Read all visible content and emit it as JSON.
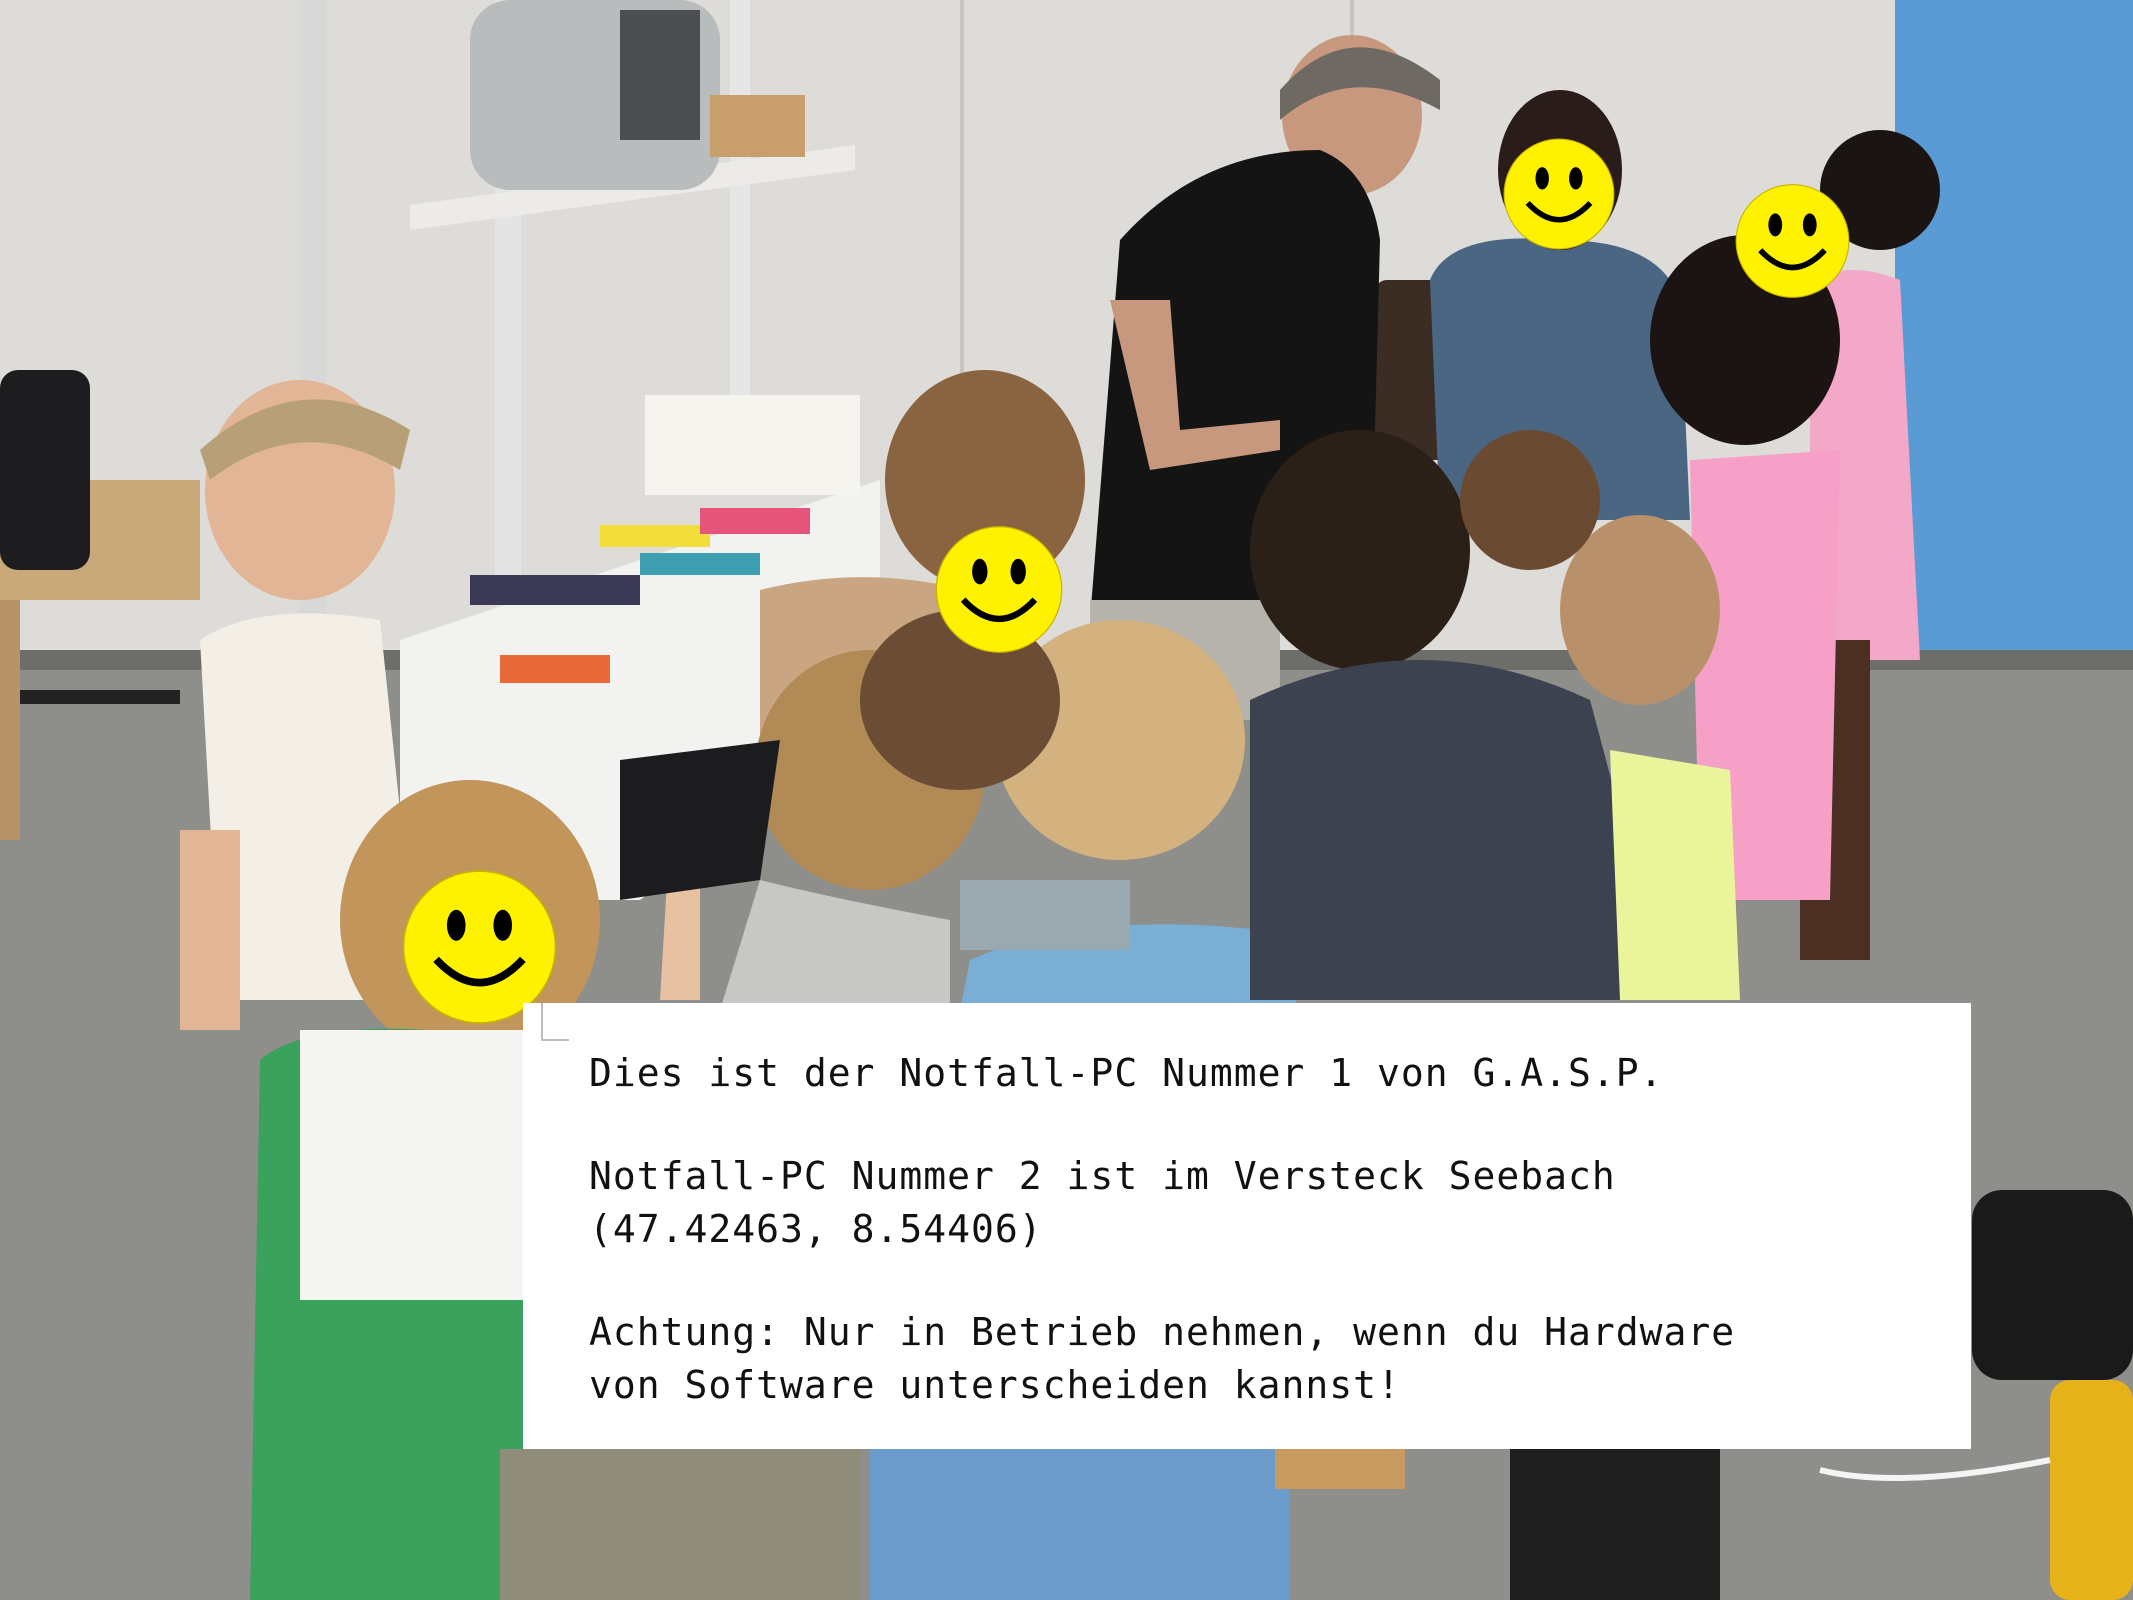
{
  "note": {
    "line1": "Dies ist der Notfall-PC Nummer 1 von G.A.S.P.",
    "line2": "Notfall-PC Nummer 2 ist im Versteck Seebach",
    "line3": "(47.42463, 8.54406)",
    "line4": "Achtung: Nur in Betrieb nehmen, wenn du Hardware",
    "line5": "von Software unterscheiden kannst!"
  },
  "photo": {
    "scene": "group-of-children-around-table",
    "faces_masked_with": "smiley-icon",
    "smiley_count": 4,
    "colors": {
      "smiley_fill": "#fff200",
      "wall_blue": "#5b9bd5",
      "floor": "#8e8e8b"
    }
  }
}
